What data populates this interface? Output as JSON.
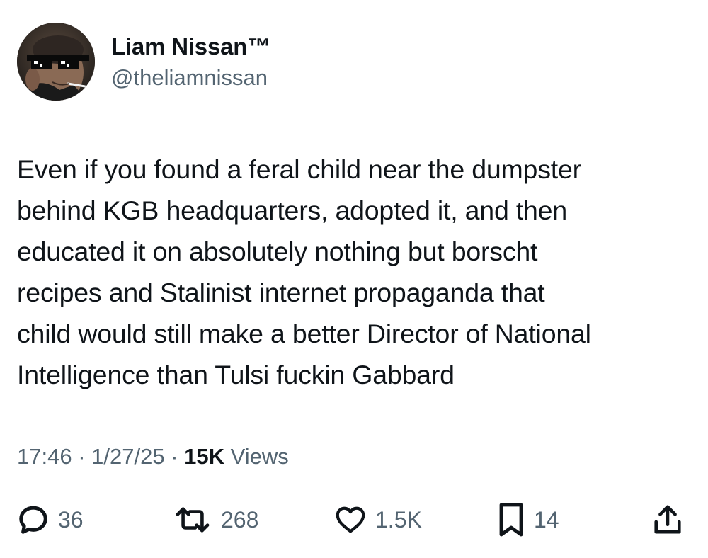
{
  "author": {
    "display_name": "Liam Nissan™",
    "handle": "@theliamnissan",
    "avatar_icon": "avatar-photo-sunglasses"
  },
  "tweet": {
    "lines": [
      "Even if you found a feral child near the dumpster",
      "behind KGB headquarters, adopted it, and then",
      "educated it on absolutely nothing but borscht",
      "recipes and Stalinist internet propaganda that",
      "child would still make a better Director of National",
      "Intelligence than Tulsi fuckin Gabbard"
    ]
  },
  "meta": {
    "time": "17:46",
    "separator": " · ",
    "date": "1/27/25",
    "views_count": "15K",
    "views_label": " Views"
  },
  "actions": {
    "reply": {
      "icon": "reply-icon",
      "count": "36"
    },
    "retweet": {
      "icon": "retweet-icon",
      "count": "268"
    },
    "like": {
      "icon": "heart-icon",
      "count": "1.5K"
    },
    "bookmark": {
      "icon": "bookmark-icon",
      "count": "14"
    },
    "share": {
      "icon": "share-icon"
    }
  },
  "colors": {
    "text_primary": "#0f1419",
    "text_secondary": "#536471",
    "background": "#ffffff"
  }
}
